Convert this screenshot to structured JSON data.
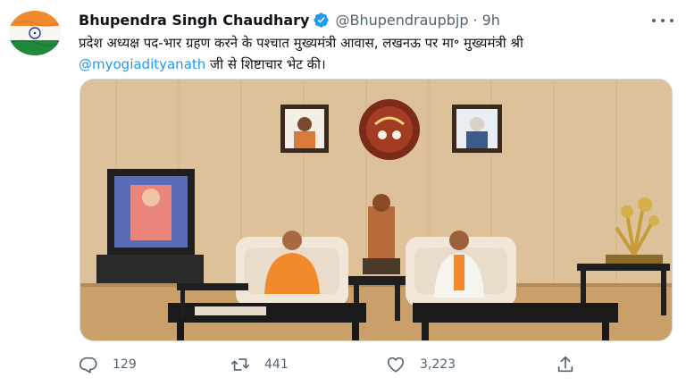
{
  "tweet": {
    "display_name": "Bhupendra Singh Chaudhary",
    "handle": "@Bhupendraupbjp",
    "separator": "·",
    "time": "9h",
    "text_part1": "प्रदेश अध्यक्ष पद-भार ग्रहण करने के पश्चात मुख्यमंत्री आवास, लखनऊ पर मा॰ मुख्यमंत्री श्री",
    "mention": "@myogiadityanath",
    "text_part2": " जी से शिष्टाचार भेट की।"
  },
  "icons": {
    "avatar": "india-flag-icon",
    "verified": "verified-badge-icon",
    "more": "more-options-icon",
    "reply": "reply-icon",
    "retweet": "retweet-icon",
    "like": "heart-icon",
    "share": "share-icon"
  },
  "colors": {
    "accent": "#1d9bf0",
    "muted_text": "#536471",
    "text": "#0f1419"
  },
  "actions": {
    "reply_count": "129",
    "retweet_count": "441",
    "like_count": "3,223"
  }
}
